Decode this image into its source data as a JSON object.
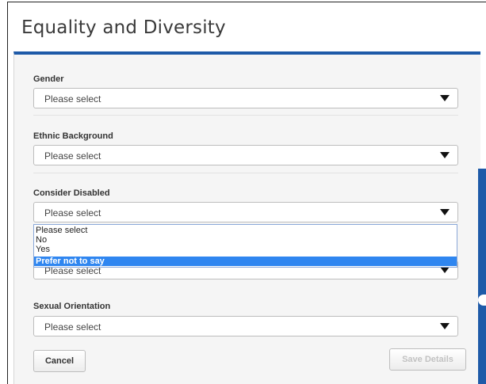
{
  "dialog": {
    "title": "Equality and Diversity"
  },
  "fields": [
    {
      "label": "Gender",
      "value": "Please select"
    },
    {
      "label": "Ethnic Background",
      "value": "Please select"
    },
    {
      "label": "Consider Disabled",
      "value": "Please select"
    },
    {
      "label": "",
      "value": "Please select"
    },
    {
      "label": "Sexual Orientation",
      "value": "Please select"
    }
  ],
  "dropdown": {
    "options": [
      "Please select",
      "No",
      "Yes",
      "Prefer not to say"
    ],
    "highlighted": "Prefer not to say"
  },
  "buttons": {
    "cancel": "Cancel",
    "save": "Save Details"
  },
  "colors": {
    "accent": "#1e5aa8",
    "highlight": "#2f86f0"
  }
}
